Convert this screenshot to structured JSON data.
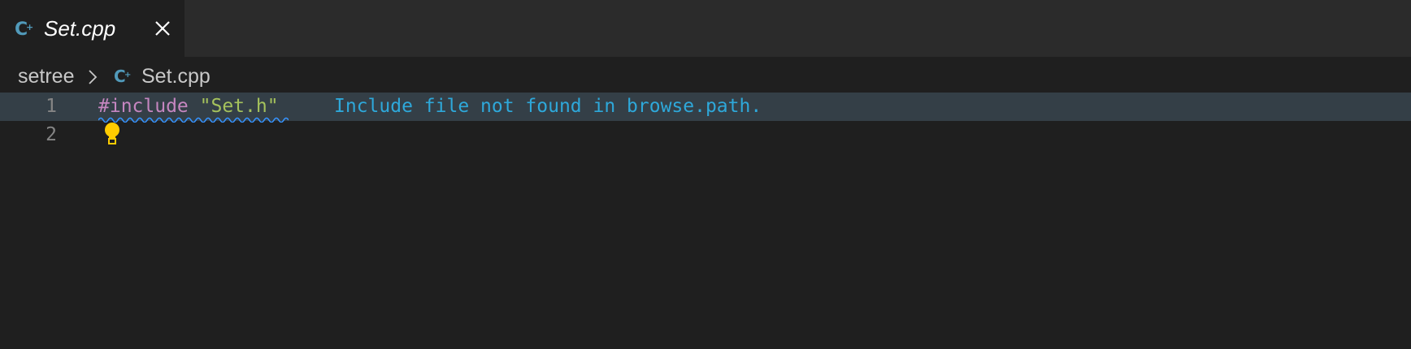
{
  "tab": {
    "icon": "cpp-file-icon",
    "label": "Set.cpp",
    "close_icon": "close-icon"
  },
  "breadcrumb": {
    "folder": "setree",
    "separator_icon": "chevron-right-icon",
    "file_icon": "cpp-file-icon",
    "file": "Set.cpp"
  },
  "editor": {
    "lines": [
      {
        "number": "1",
        "directive": "#include",
        "space": " ",
        "string": "\"Set.h\"",
        "diagnostic": "Include file not found in browse.path."
      },
      {
        "number": "2",
        "code": ""
      }
    ],
    "lightbulb_icon": "lightbulb-icon"
  },
  "colors": {
    "background": "#1f1f1f",
    "tabbar": "#2b2b2b",
    "current_line": "#343f47",
    "include_keyword": "#c586c0",
    "string": "#a5c25c",
    "diagnostic_text": "#2ea8da",
    "squiggle": "#3794ff",
    "lightbulb": "#ffcc00",
    "cpp_icon": "#519aba"
  }
}
